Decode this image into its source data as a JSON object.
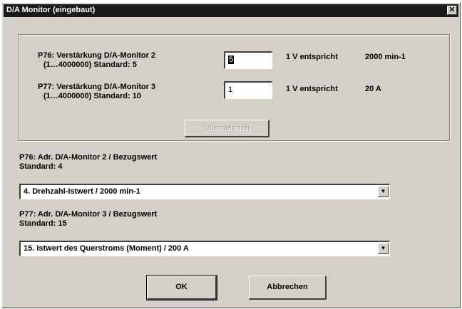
{
  "window": {
    "title": "D/A Monitor (eingebaut)",
    "close_glyph": "✕"
  },
  "params": [
    {
      "label_line1": "P76: Verstärkung D/A-Monitor 2",
      "label_line2": "(1…4000000)  Standard: 5",
      "value": "5",
      "equiv_label": "1 V entspricht",
      "equiv_value": "2000 min-1"
    },
    {
      "label_line1": "P77: Verstärkung D/A-Monitor 3",
      "label_line2": "(1…4000000)  Standard: 10",
      "value": "1",
      "equiv_label": "1 V entspricht",
      "equiv_value": "20 A"
    }
  ],
  "apply_button": "Übernehmen",
  "refs": [
    {
      "label_line1": "P76: Adr. D/A-Monitor 2  /  Bezugswert",
      "label_line2": "Standard: 4",
      "selected": "4. Drehzahl-Istwert  /  2000 min-1"
    },
    {
      "label_line1": "P77: Adr. D/A-Monitor 3  /  Bezugswert",
      "label_line2": "Standard: 15",
      "selected": "15. Istwert des Querstroms (Moment)  /  200 A"
    }
  ],
  "ok_button": "OK",
  "cancel_button": "Abbrechen"
}
